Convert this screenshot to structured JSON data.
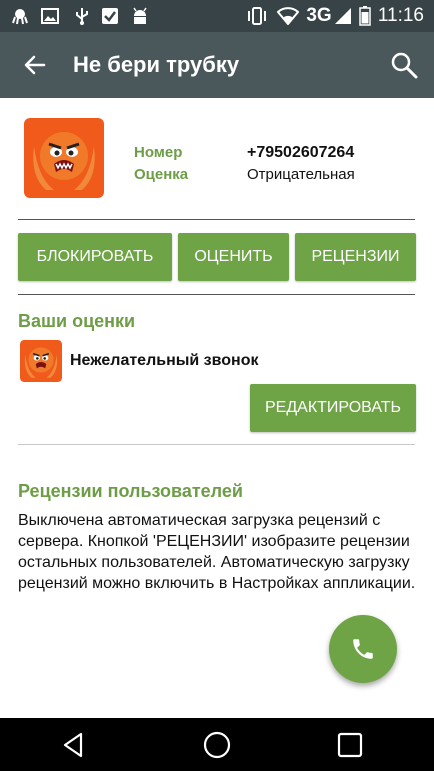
{
  "statusbar": {
    "icons": [
      "octopus-icon",
      "image-icon",
      "usb-icon",
      "checkbox-icon",
      "android-icon",
      "vibrate-icon",
      "wifi-icon",
      "signal-icon",
      "battery-icon"
    ],
    "network": "3G",
    "time": "11:16"
  },
  "appbar": {
    "title": "Не бери трубку",
    "back_icon": "arrow-back-icon",
    "search_icon": "search-icon"
  },
  "caller": {
    "number_label": "Номер",
    "number_value": "+79502607264",
    "rating_label": "Оценка",
    "rating_value": "Отрицательная"
  },
  "actions": {
    "block": "БЛОКИРОВАТЬ",
    "rate": "ОЦЕНИТЬ",
    "reviews": "РЕЦЕНЗИИ"
  },
  "your_ratings": {
    "title": "Ваши оценки",
    "item": "Нежелательный звонок",
    "edit": "РЕДАКТИРОВАТЬ"
  },
  "user_reviews": {
    "title": "Рецензии пользователей",
    "body": "Выключена автоматическая загрузка рецензий с сервера. Кнопкой 'РЕЦЕНЗИИ' изобразите рецензии остальных пользователей. Автоматическую загрузку рецензий можно включить в Настройках аппликации."
  },
  "colors": {
    "accent": "#6ea346",
    "appbar": "#4b585b",
    "statusbar": "#374346"
  }
}
